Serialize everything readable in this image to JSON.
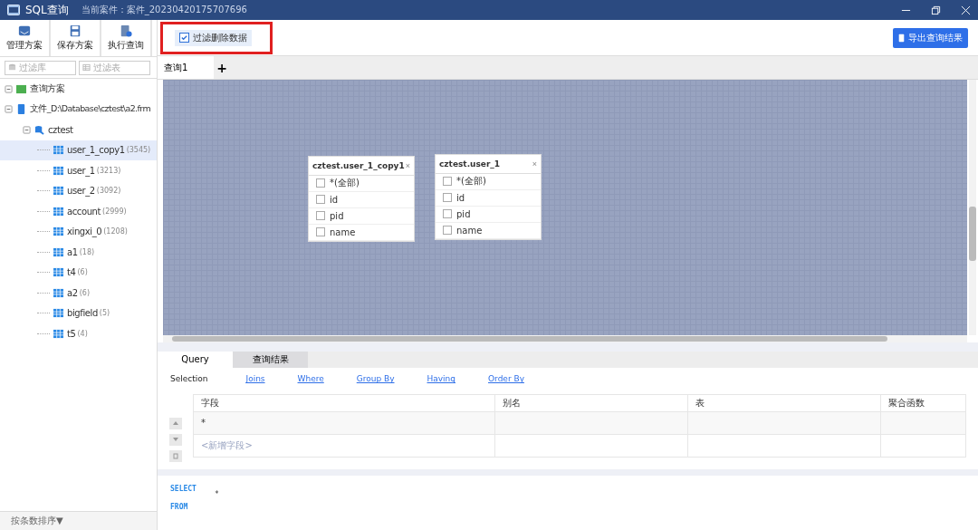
{
  "window": {
    "title": "SQL查询",
    "subtitle": "当前案件：案件_20230420175707696"
  },
  "toolbar": [
    {
      "label": "管理方案",
      "kind": "manage"
    },
    {
      "label": "保存方案",
      "kind": "save"
    },
    {
      "label": "执行查询",
      "kind": "run"
    }
  ],
  "filters": [
    {
      "placeholder": "过滤库",
      "kind": "db"
    },
    {
      "placeholder": "过滤表",
      "kind": "table"
    }
  ],
  "tree": [
    {
      "label": "查询方案",
      "kind": "plan",
      "expanded": true,
      "selected": false
    },
    {
      "label": "文件_D:\\Database\\cztest\\a2.frm",
      "kind": "file",
      "expanded": true,
      "selected": false,
      "children": [
        {
          "label": "cztest",
          "kind": "db",
          "expanded": true,
          "selected": false,
          "children": [
            {
              "label": "user_1_copy1",
              "count": "(3545)",
              "kind": "table",
              "selected": true
            },
            {
              "label": "user_1",
              "count": "(3213)",
              "kind": "table",
              "selected": false
            },
            {
              "label": "user_2",
              "count": "(3092)",
              "kind": "table",
              "selected": false
            },
            {
              "label": "account",
              "count": "(2999)",
              "kind": "table",
              "selected": false
            },
            {
              "label": "xingxi_0",
              "count": "(1208)",
              "kind": "table",
              "selected": false
            },
            {
              "label": "a1",
              "count": "(18)",
              "kind": "table",
              "selected": false
            },
            {
              "label": "t4",
              "count": "(6)",
              "kind": "table",
              "selected": false
            },
            {
              "label": "a2",
              "count": "(6)",
              "kind": "table",
              "selected": false
            },
            {
              "label": "bigfield",
              "count": "(5)",
              "kind": "table",
              "selected": false
            },
            {
              "label": "t5",
              "count": "(4)",
              "kind": "table",
              "selected": false
            }
          ]
        }
      ]
    }
  ],
  "sort_button": "按条数排序▼",
  "filter_deleted": {
    "label": "过滤删除数据",
    "checked": true,
    "highlighted": true
  },
  "export_button": "导出查询结果",
  "query_tabs": [
    {
      "label": "查询1",
      "selected": true
    }
  ],
  "add_tab": "+",
  "canvas_tables": [
    {
      "title": "cztest.user_1_copy1",
      "close": "×",
      "fields": [
        {
          "name": "*(全部)",
          "checked": false
        },
        {
          "name": "id",
          "checked": false
        },
        {
          "name": "pid",
          "checked": false
        },
        {
          "name": "name",
          "checked": false
        }
      ]
    },
    {
      "title": "cztest.user_1",
      "close": "×",
      "fields": [
        {
          "name": "*(全部)",
          "checked": false
        },
        {
          "name": "id",
          "checked": false
        },
        {
          "name": "pid",
          "checked": false
        },
        {
          "name": "name",
          "checked": false
        }
      ]
    }
  ],
  "bottom_tabs": [
    {
      "label": "Query",
      "selected": true
    },
    {
      "label": "查询结果",
      "selected": false
    }
  ],
  "clauses": [
    {
      "label": "Selection",
      "selected": true
    },
    {
      "label": "Joins",
      "selected": false
    },
    {
      "label": "Where",
      "selected": false
    },
    {
      "label": "Group By",
      "selected": false
    },
    {
      "label": "Having",
      "selected": false
    },
    {
      "label": "Order By",
      "selected": false
    }
  ],
  "grid": {
    "columns": [
      "字段",
      "别名",
      "表",
      "聚合函数"
    ],
    "rows": [
      {
        "cells": [
          "*",
          "",
          "",
          ""
        ],
        "kind": "field"
      },
      {
        "cells": [
          "<新增字段>",
          "",
          "",
          ""
        ],
        "kind": "new"
      }
    ]
  },
  "sql": [
    {
      "keyword": "SELECT",
      "value": "*"
    },
    {
      "keyword": "FROM"
    }
  ]
}
